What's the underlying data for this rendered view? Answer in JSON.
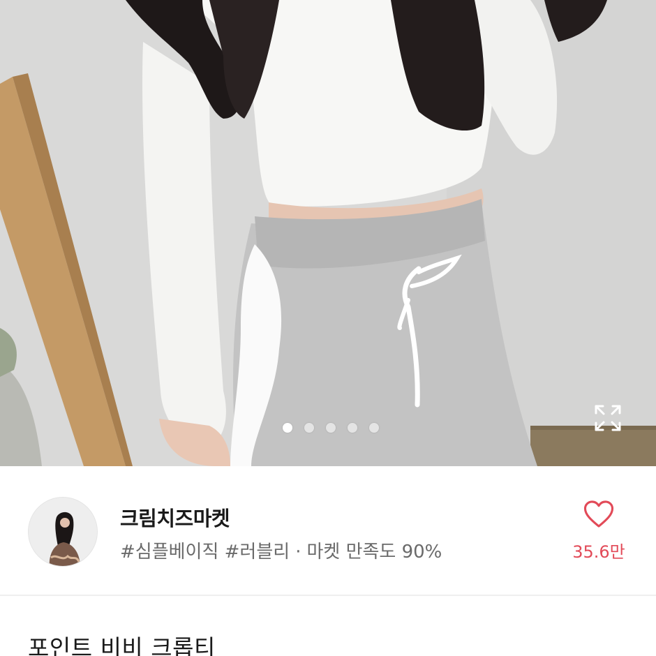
{
  "gallery": {
    "image_alt": "product photo",
    "pages_total": 5,
    "active_page": 1,
    "expand_icon": "expand-icon"
  },
  "seller": {
    "name": "크림치즈마켓",
    "tags": "#심플베이직 #러블리",
    "separator": "·",
    "satisfaction": "마켓 만족도 90%",
    "avatar_icon": "seller-avatar"
  },
  "like": {
    "icon": "heart-outline-icon",
    "count": "35.6만",
    "color": "#e24a58"
  },
  "product": {
    "title": "포인트 비비 크롭티"
  }
}
